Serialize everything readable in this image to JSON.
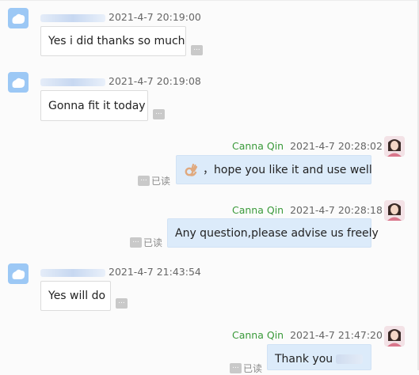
{
  "agent_name": "Canna Qin",
  "read_label": "已读",
  "more_glyph": "...",
  "messages": [
    {
      "sender": "customer",
      "time": "2021-4-7 20:19:00",
      "text": "Yes i did thanks so much"
    },
    {
      "sender": "customer",
      "time": "2021-4-7 20:19:08",
      "text": "Gonna fit it today"
    },
    {
      "sender": "agent",
      "time": "2021-4-7 20:28:02",
      "emoji": "ok-hand-icon",
      "text": "，hope you like it and use well"
    },
    {
      "sender": "agent",
      "time": "2021-4-7 20:28:18",
      "text": "Any question,please advise us freely"
    },
    {
      "sender": "customer",
      "time": "2021-4-7 21:43:54",
      "text": "Yes will do"
    },
    {
      "sender": "agent",
      "time": "2021-4-7 21:47:20",
      "text": "Thank you"
    }
  ],
  "colors": {
    "agent_name": "#3a9a3a",
    "outgoing_bubble": "#dcebfa",
    "incoming_bubble": "#ffffff",
    "customer_avatar": "#9cc8f5",
    "more_button": "#c9c9c9"
  }
}
